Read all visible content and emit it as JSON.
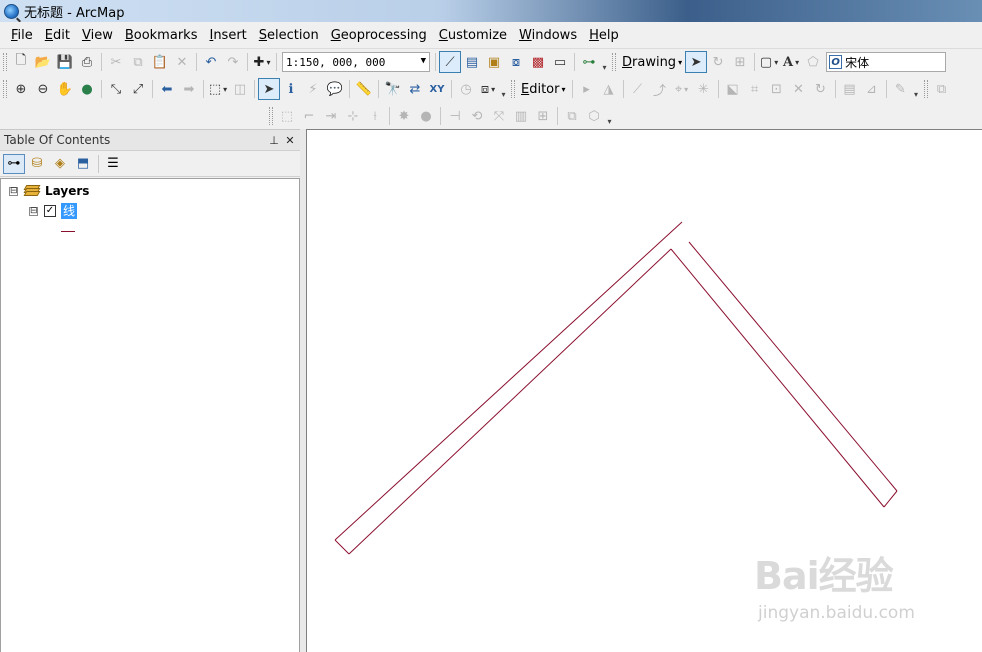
{
  "window": {
    "title": "无标题 - ArcMap"
  },
  "menu": [
    {
      "label": "File",
      "u": "F",
      "rest": "ile"
    },
    {
      "label": "Edit",
      "u": "E",
      "rest": "dit"
    },
    {
      "label": "View",
      "u": "V",
      "rest": "iew"
    },
    {
      "label": "Bookmarks",
      "u": "B",
      "rest": "ookmarks"
    },
    {
      "label": "Insert",
      "u": "I",
      "rest": "nsert"
    },
    {
      "label": "Selection",
      "u": "S",
      "rest": "election"
    },
    {
      "label": "Geoprocessing",
      "u": "G",
      "rest": "eoprocessing"
    },
    {
      "label": "Customize",
      "u": "C",
      "rest": "ustomize"
    },
    {
      "label": "Windows",
      "u": "W",
      "rest": "indows"
    },
    {
      "label": "Help",
      "u": "H",
      "rest": "elp"
    }
  ],
  "toolbar": {
    "scale_value": "1:150, 000, 000",
    "drawing_u": "D",
    "drawing_rest": "rawing",
    "editor_u": "E",
    "editor_rest": "ditor",
    "font_value": "宋体"
  },
  "toc": {
    "title": "Table Of Contents",
    "pin_glyph": "⊥",
    "close_glyph": "✕",
    "root_label": "Layers",
    "layer_name": "线",
    "layer_checked": "✓",
    "expander_glyph": "⊟"
  },
  "colors": {
    "line_feature": "#8b1030",
    "selection": "#3399ff"
  },
  "watermark": {
    "main": "Bai经验",
    "sub": "jingyan.baidu.com"
  }
}
